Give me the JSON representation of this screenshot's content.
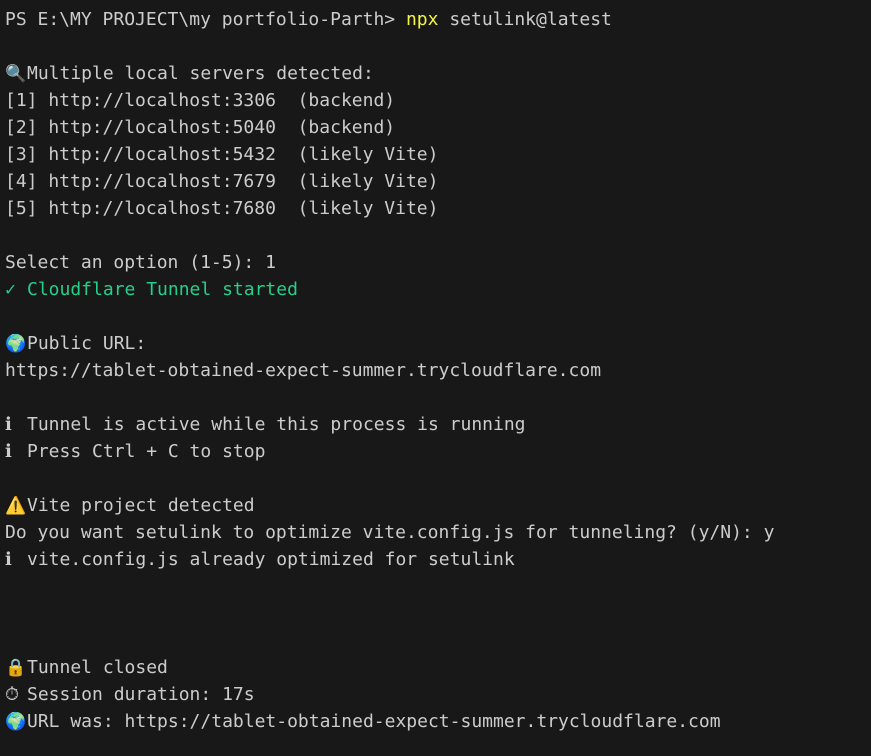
{
  "prompt": {
    "ps": "PS E:\\MY PROJECT\\my portfolio-Parth> ",
    "cmd": "npx",
    "args": " setulink@latest"
  },
  "detect": {
    "icon": "magnifier-icon",
    "glyph": "🔍",
    "text": "Multiple local servers detected:"
  },
  "servers": [
    "[1] http://localhost:3306  (backend)",
    "[2] http://localhost:5040  (backend)",
    "[3] http://localhost:5432  (likely Vite)",
    "[4] http://localhost:7679  (likely Vite)",
    "[5] http://localhost:7680  (likely Vite)"
  ],
  "select": "Select an option (1-5): 1",
  "started": {
    "check": "✓",
    "text": "Cloudflare Tunnel started"
  },
  "public": {
    "icon": "globe-icon",
    "glyph": "🌍",
    "label": "Public URL:",
    "url": "https://tablet-obtained-expect-summer.trycloudflare.com"
  },
  "info": {
    "glyph": "ℹ",
    "active": "Tunnel is active while this process is running",
    "stop": "Press Ctrl + C to stop"
  },
  "vite": {
    "icon": "warning-icon",
    "glyph": "⚠️",
    "detected": "Vite project detected",
    "question": "Do you want setulink to optimize vite.config.js for tunneling? (y/N): y",
    "optimized": "vite.config.js already optimized for setulink"
  },
  "closed": {
    "lock_icon": "lock-icon",
    "lock_glyph": "🔒",
    "text": "Tunnel closed",
    "timer_icon": "stopwatch-icon",
    "timer_glyph": "⏱",
    "duration": "Session duration: 17s",
    "globe_icon": "globe-icon",
    "globe_glyph": "🌍",
    "url_was": "URL was: https://tablet-obtained-expect-summer.trycloudflare.com"
  },
  "colors": {
    "background": "#181818",
    "text": "#cccccc",
    "command": "#f5f543",
    "success": "#23d18b"
  }
}
